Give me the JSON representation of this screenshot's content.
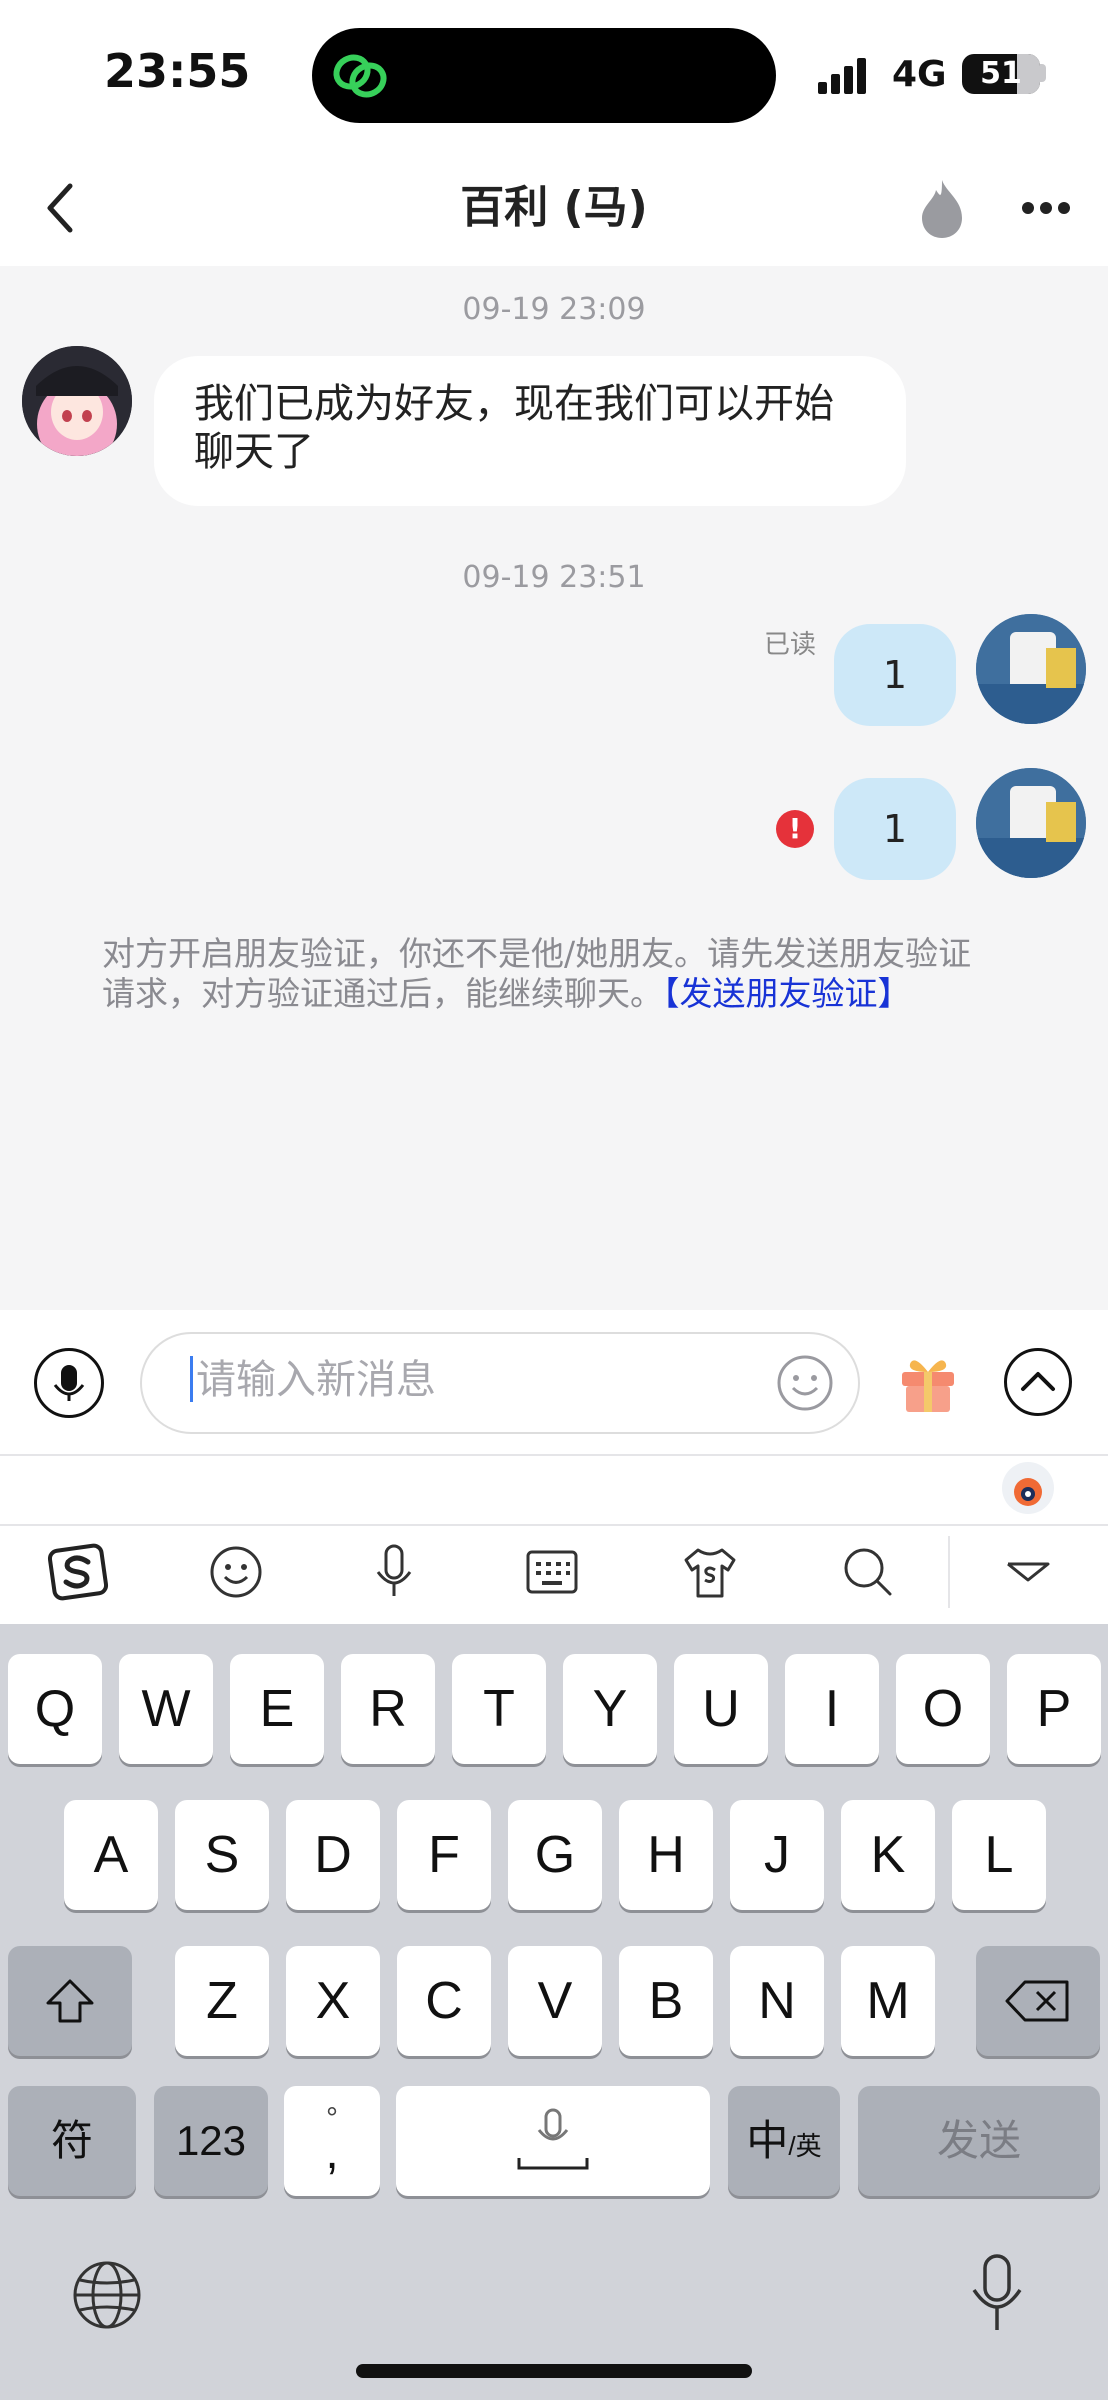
{
  "status_bar": {
    "time": "23:55",
    "network": "4G",
    "battery": "51"
  },
  "header": {
    "title": "百利 (马)"
  },
  "chat": {
    "timestamp_1": "09-19 23:09",
    "message_1": "我们已成为好友，现在我们可以开始聊天了",
    "timestamp_2": "09-19 23:51",
    "read_status": "已读",
    "message_2": "1",
    "message_3": "1",
    "error_mark": "!",
    "notice_text": "对方开启朋友验证，你还不是他/她朋友。请先发送朋友验证请求，对方验证通过后，能继续聊天。",
    "notice_link": "【发送朋友验证】"
  },
  "input": {
    "placeholder": "请输入新消息"
  },
  "keyboard": {
    "row1": [
      "Q",
      "W",
      "E",
      "R",
      "T",
      "Y",
      "U",
      "I",
      "O",
      "P"
    ],
    "row2": [
      "A",
      "S",
      "D",
      "F",
      "G",
      "H",
      "J",
      "K",
      "L"
    ],
    "row3": [
      "Z",
      "X",
      "C",
      "V",
      "B",
      "N",
      "M"
    ],
    "symbol_key": "符",
    "number_key": "123",
    "punct_top": "°",
    "punct_bottom": ",",
    "lang_main": "中",
    "lang_sub": "/英",
    "send_key": "发送"
  }
}
